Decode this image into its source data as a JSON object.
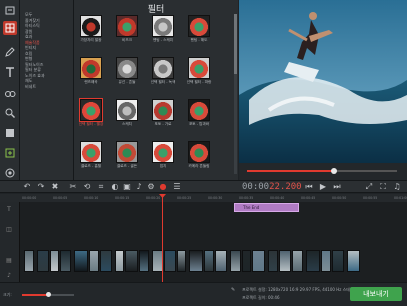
{
  "panel": {
    "title": "필터"
  },
  "categories": [
    "모두",
    "즐겨찾기",
    "아티스틱",
    "광원",
    "효과",
    "예술작품",
    "빈티지",
    "흐림",
    "변형",
    "필터노이즈",
    "필터 분류",
    "노이즈 효과",
    "채도",
    "비네트"
  ],
  "selected_category_index": 5,
  "filters": [
    {
      "label": "가장자리 발광",
      "palette": [
        "#c0392b",
        "#1a1a1a",
        "#e0e0e0"
      ],
      "selected": false
    },
    {
      "label": "비즈크",
      "palette": [
        "#3aa06a",
        "#c0392b",
        "#5a2a2a"
      ],
      "selected": false
    },
    {
      "label": "펜팅 - 스케치",
      "palette": [
        "#c6c6c6",
        "#7a7a7a",
        "#e8e8e8"
      ],
      "selected": false
    },
    {
      "label": "펜팅 - 해도",
      "palette": [
        "#3aa06a",
        "#d84a3a",
        "#222"
      ],
      "selected": false
    },
    {
      "label": "렌즈왜곡",
      "palette": [
        "#1f6a3a",
        "#c0392b",
        "#d8a050"
      ],
      "selected": false
    },
    {
      "label": "유선 - 흔들",
      "palette": [
        "#d9d9d9",
        "#888",
        "#444"
      ],
      "selected": false
    },
    {
      "label": "선택 필터 - 녹색",
      "palette": [
        "#7a7a7a",
        "#c8c8c8",
        "#3a3a3a"
      ],
      "selected": false
    },
    {
      "label": "선택 필터 - 파랑",
      "palette": [
        "#3aa06a",
        "#d84a3a",
        "#cfcfcf"
      ],
      "selected": false
    },
    {
      "label": "선택 필터 - 빨강",
      "palette": [
        "#3aa06a",
        "#e0473a",
        "#2a2a2a"
      ],
      "selected": true
    },
    {
      "label": "스케치",
      "palette": [
        "#bdbdbd",
        "#666",
        "#eee"
      ],
      "selected": false
    },
    {
      "label": "포토 - 가로",
      "palette": [
        "#2f8a55",
        "#b83a30",
        "#d0d0d0"
      ],
      "selected": false
    },
    {
      "label": "포토 - 탑과바",
      "palette": [
        "#3aa06a",
        "#d84a3a",
        "#1a1a1a"
      ],
      "selected": false
    },
    {
      "label": "클로즈 - 흡혈",
      "palette": [
        "#3aa06a",
        "#d84a3a",
        "#ddd"
      ],
      "selected": false
    },
    {
      "label": "클로즈 - 골든",
      "palette": [
        "#2f8a55",
        "#c24a36",
        "#999"
      ],
      "selected": false
    },
    {
      "label": "접지",
      "palette": [
        "#3aa06a",
        "#d84a3a",
        "#eee"
      ],
      "selected": false
    },
    {
      "label": "카메라 흔들림",
      "palette": [
        "#2f8a55",
        "#d84a3a",
        "#1a1a1a"
      ],
      "selected": false
    }
  ],
  "timecode": {
    "main": "00:00",
    "sub": "22.200"
  },
  "preview_progress": 0.58,
  "zoom_fraction": 0.5,
  "ruler": [
    "00:00:00",
    "00:00:05",
    "00:00:10",
    "00:00:15",
    "00:00:20",
    "00:00:25",
    "00:00:30",
    "00:00:35",
    "00:00:40",
    "00:00:45",
    "00:00:50",
    "00:00:55",
    "00:01:00"
  ],
  "title_clip": {
    "label": "The End"
  },
  "status": {
    "zoom_label": "크기:",
    "settings": "프로젝트 설정: 1280x720 16:9 29.97 FPS, 44100 Hz 스테레오",
    "length": "프로젝트 길이: 00:46",
    "export": "내보내기"
  },
  "colors": {
    "accent": "#e03a2f",
    "export": "#3fa34d",
    "title_clip": "#b07bc4"
  },
  "toolbar_icons": [
    "undo-icon",
    "redo-icon",
    "delete-icon",
    "cut-icon",
    "rotate-icon",
    "crop-icon",
    "color-icon",
    "image-icon",
    "mic-icon",
    "settings-icon",
    "record-icon",
    "equalizer-icon"
  ],
  "playback_icons": [
    "previous-icon",
    "play-icon",
    "next-icon"
  ]
}
